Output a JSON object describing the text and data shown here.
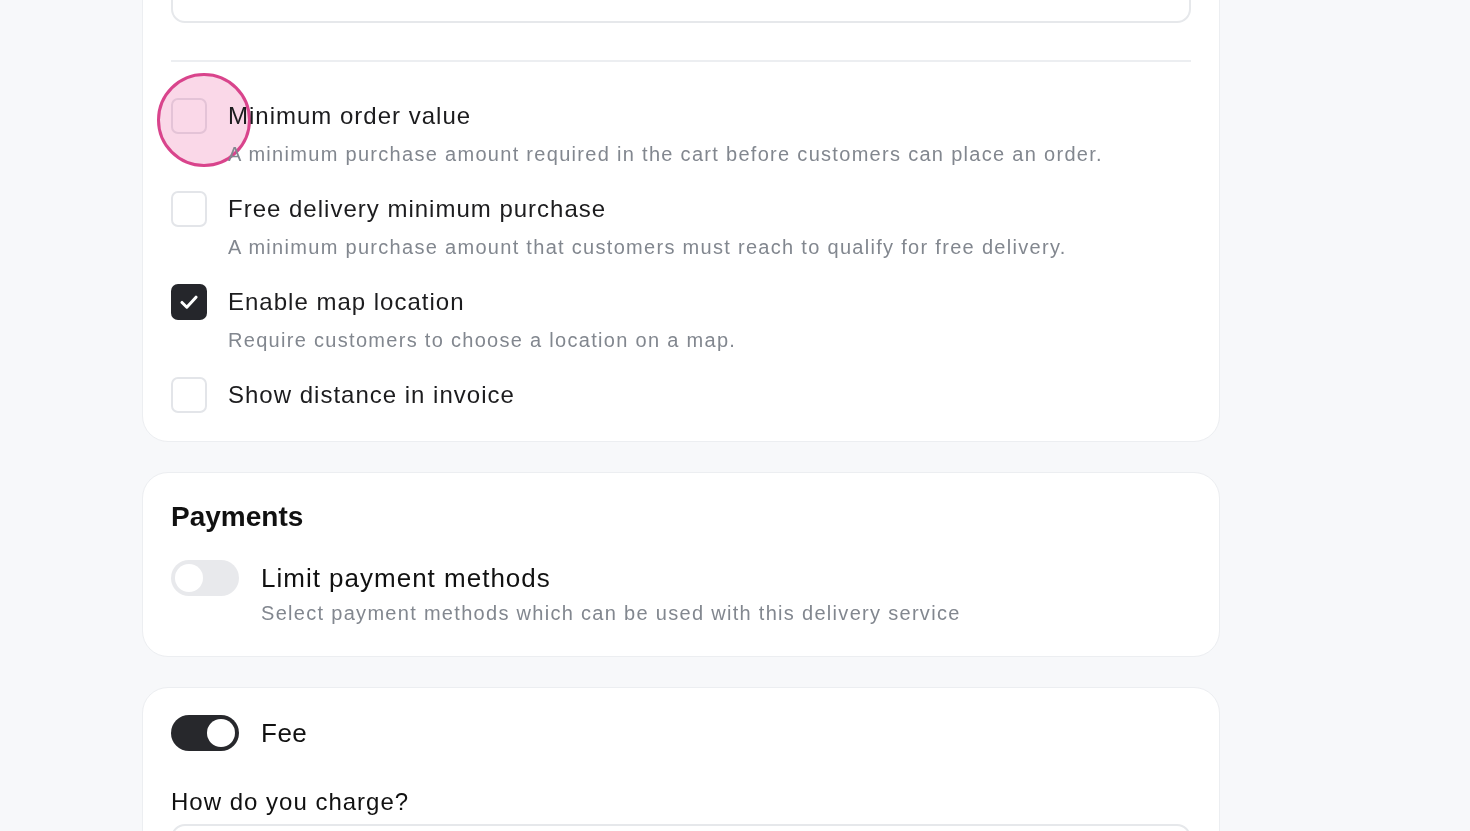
{
  "delivery_options": {
    "options": [
      {
        "kind": "checkbox",
        "label": "Minimum order value",
        "description": "A minimum purchase amount required in the cart before customers can place an order.",
        "checked": false,
        "highlighted": true
      },
      {
        "kind": "checkbox",
        "label": "Free delivery minimum purchase",
        "description": "A minimum purchase amount that customers must reach to qualify for free delivery.",
        "checked": false,
        "highlighted": false
      },
      {
        "kind": "checkbox",
        "label": "Enable map location",
        "description": "Require customers to choose a location on a map.",
        "checked": true,
        "highlighted": false
      },
      {
        "kind": "checkbox",
        "label": "Show distance in invoice",
        "checked": false,
        "highlighted": false
      }
    ]
  },
  "payments": {
    "title": "Payments",
    "limit_payment_methods": {
      "label": "Limit payment methods",
      "description": "Select payment methods which can be used with this delivery service",
      "on": false
    }
  },
  "fee": {
    "label": "Fee",
    "on": true,
    "charge_question": "How do you charge?"
  }
}
